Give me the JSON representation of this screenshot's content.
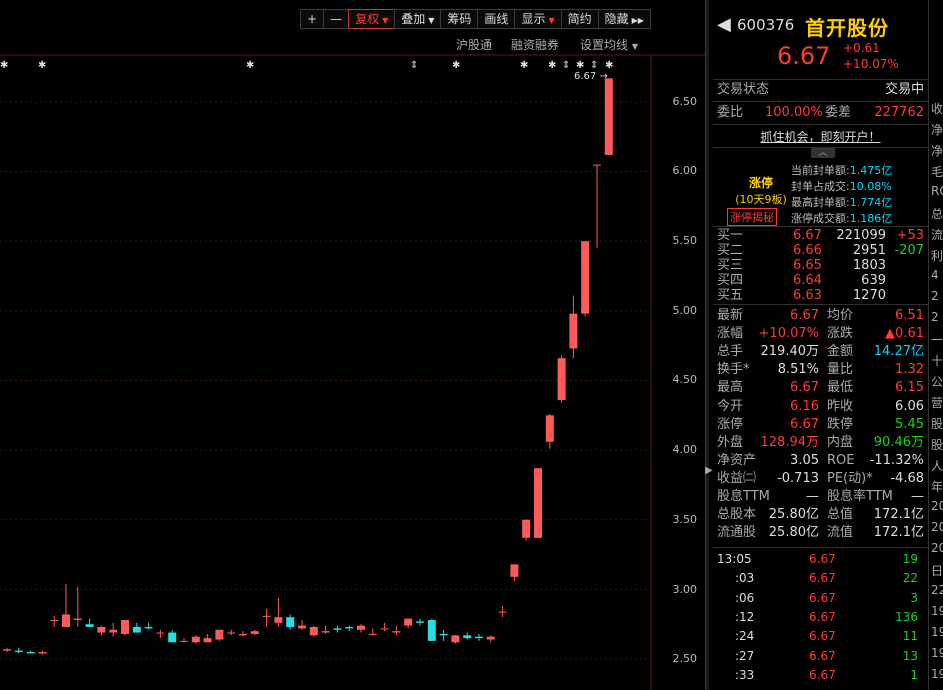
{
  "toolbar": {
    "plus": "+",
    "minus": "—",
    "items": [
      {
        "label": "复权",
        "caret": "▼"
      },
      {
        "label": "叠加",
        "caret": "▼"
      },
      {
        "label": "筹码"
      },
      {
        "label": "画线"
      },
      {
        "label": "显示",
        "caret": "▼"
      },
      {
        "label": "简约"
      },
      {
        "label": "隐藏",
        "caret": "▶▶"
      }
    ]
  },
  "subnav": [
    "沪股通",
    "融资融券",
    "设置均线"
  ],
  "subnav_caret": "▼",
  "price_marker": "6.67",
  "y_ticks": [
    "6.50",
    "6.00",
    "5.50",
    "5.00",
    "4.50",
    "4.00",
    "3.50",
    "3.00",
    "2.50"
  ],
  "colors": {
    "up": "#ff5a5a",
    "down": "#22e1e6",
    "bg": "#000000",
    "grid": "#3a1010",
    "accent": "#ffcc00"
  },
  "chart_data": {
    "type": "candlestick",
    "ylim": [
      2.3,
      6.9
    ],
    "ohlc": [
      [
        2.56,
        2.58,
        2.55,
        2.57
      ],
      [
        2.56,
        2.58,
        2.54,
        2.55
      ],
      [
        2.55,
        2.56,
        2.54,
        2.54
      ],
      [
        2.54,
        2.56,
        2.53,
        2.55
      ],
      [
        2.78,
        2.81,
        2.73,
        2.78
      ],
      [
        2.73,
        3.04,
        2.73,
        2.82
      ],
      [
        2.78,
        3.02,
        2.73,
        2.79
      ],
      [
        2.75,
        2.79,
        2.73,
        2.73
      ],
      [
        2.69,
        2.74,
        2.67,
        2.73
      ],
      [
        2.69,
        2.76,
        2.66,
        2.71
      ],
      [
        2.68,
        2.78,
        2.67,
        2.78
      ],
      [
        2.73,
        2.76,
        2.69,
        2.69
      ],
      [
        2.73,
        2.76,
        2.71,
        2.72
      ],
      [
        2.69,
        2.71,
        2.65,
        2.69
      ],
      [
        2.69,
        2.71,
        2.62,
        2.62
      ],
      [
        2.63,
        2.65,
        2.62,
        2.63
      ],
      [
        2.62,
        2.67,
        2.61,
        2.66
      ],
      [
        2.62,
        2.68,
        2.62,
        2.65
      ],
      [
        2.64,
        2.7,
        2.63,
        2.71
      ],
      [
        2.69,
        2.71,
        2.67,
        2.69
      ],
      [
        2.67,
        2.7,
        2.66,
        2.68
      ],
      [
        2.68,
        2.71,
        2.67,
        2.7
      ],
      [
        2.81,
        2.86,
        2.73,
        2.81
      ],
      [
        2.76,
        2.94,
        2.73,
        2.8
      ],
      [
        2.8,
        2.82,
        2.71,
        2.73
      ],
      [
        2.72,
        2.78,
        2.71,
        2.74
      ],
      [
        2.67,
        2.74,
        2.66,
        2.73
      ],
      [
        2.69,
        2.74,
        2.68,
        2.7
      ],
      [
        2.72,
        2.74,
        2.69,
        2.71
      ],
      [
        2.73,
        2.74,
        2.7,
        2.72
      ],
      [
        2.71,
        2.75,
        2.69,
        2.74
      ],
      [
        2.68,
        2.72,
        2.67,
        2.68
      ],
      [
        2.72,
        2.76,
        2.7,
        2.72
      ],
      [
        2.69,
        2.74,
        2.67,
        2.7
      ],
      [
        2.74,
        2.78,
        2.72,
        2.79
      ],
      [
        2.77,
        2.79,
        2.74,
        2.76
      ],
      [
        2.78,
        2.79,
        2.63,
        2.63
      ],
      [
        2.68,
        2.71,
        2.63,
        2.67
      ],
      [
        2.62,
        2.67,
        2.61,
        2.67
      ],
      [
        2.67,
        2.69,
        2.64,
        2.65
      ],
      [
        2.66,
        2.68,
        2.63,
        2.65
      ],
      [
        2.64,
        2.67,
        2.62,
        2.66
      ],
      [
        2.84,
        2.88,
        2.8,
        2.84
      ],
      [
        3.09,
        3.18,
        3.06,
        3.18
      ],
      [
        3.37,
        3.5,
        3.35,
        3.5
      ],
      [
        3.37,
        3.87,
        3.37,
        3.87
      ],
      [
        4.06,
        4.26,
        4.01,
        4.25
      ],
      [
        4.36,
        4.68,
        4.34,
        4.66
      ],
      [
        4.73,
        5.11,
        4.66,
        4.98
      ],
      [
        4.98,
        5.5,
        4.96,
        5.5
      ],
      [
        6.05,
        6.05,
        5.45,
        6.05
      ],
      [
        6.12,
        6.67,
        6.12,
        6.67
      ]
    ]
  },
  "stock": {
    "code": "600376",
    "name": "首开股份",
    "price": "6.67",
    "change": "+0.61",
    "pct": "+10.07%",
    "status_label": "交易状态",
    "status_value": "交易中",
    "wb_label": "委比",
    "wb_value": "100.00%",
    "wc_label": "委差",
    "wc_value": "227762",
    "promo": "抓住机会，即刻开户！",
    "limit_label": "涨停",
    "limit_sub": "(10天9板)",
    "limit_btn": "涨停揭秘",
    "limit_info": [
      {
        "k": "当前封单额:",
        "v": "1.475亿"
      },
      {
        "k": "封单占成交:",
        "v": "10.08%"
      },
      {
        "k": "最高封单额:",
        "v": "1.774亿"
      },
      {
        "k": "涨停成交额:",
        "v": "1.186亿"
      }
    ],
    "book": [
      {
        "label": "买一",
        "price": "6.67",
        "vol": "221099",
        "chg": "+53",
        "chg_color": "red"
      },
      {
        "label": "买二",
        "price": "6.66",
        "vol": "2951",
        "chg": "-207",
        "chg_color": "grn"
      },
      {
        "label": "买三",
        "price": "6.65",
        "vol": "1803",
        "chg": ""
      },
      {
        "label": "买四",
        "price": "6.64",
        "vol": "639",
        "chg": ""
      },
      {
        "label": "买五",
        "price": "6.63",
        "vol": "1270",
        "chg": ""
      }
    ],
    "stats": [
      {
        "l1": "最新",
        "v1": "6.67",
        "c1": "red",
        "l2": "均价",
        "v2": "6.51",
        "c2": "red"
      },
      {
        "l1": "涨幅",
        "v1": "+10.07%",
        "c1": "red",
        "l2": "涨跌",
        "v2": "▲0.61",
        "c2": "red"
      },
      {
        "l1": "总手",
        "v1": "219.40万",
        "c1": "wht",
        "l2": "金额",
        "v2": "14.27亿",
        "c2": "cyan"
      },
      {
        "l1": "换手*",
        "v1": "8.51%",
        "c1": "wht",
        "l2": "量比",
        "v2": "1.32",
        "c2": "red"
      },
      {
        "l1": "最高",
        "v1": "6.67",
        "c1": "red",
        "l2": "最低",
        "v2": "6.15",
        "c2": "red"
      },
      {
        "l1": "今开",
        "v1": "6.16",
        "c1": "red",
        "l2": "昨收",
        "v2": "6.06",
        "c2": "wht"
      },
      {
        "l1": "涨停",
        "v1": "6.67",
        "c1": "red",
        "l2": "跌停",
        "v2": "5.45",
        "c2": "grn"
      },
      {
        "l1": "外盘",
        "v1": "128.94万",
        "c1": "red",
        "l2": "内盘",
        "v2": "90.46万",
        "c2": "grn"
      },
      {
        "l1": "净资产",
        "v1": "3.05",
        "c1": "wht",
        "l2": "ROE",
        "v2": "-11.32%",
        "c2": "wht"
      },
      {
        "l1": "收益㈡",
        "v1": "-0.713",
        "c1": "wht",
        "l2": "PE(动)*",
        "v2": "-4.68",
        "c2": "wht"
      },
      {
        "l1": "股息TTM",
        "v1": "—",
        "c1": "wht",
        "l2": "股息率TTM",
        "v2": "—",
        "c2": "wht"
      },
      {
        "l1": "总股本",
        "v1": "25.80亿",
        "c1": "wht",
        "l2": "总值",
        "v2": "172.1亿",
        "c2": "wht"
      },
      {
        "l1": "流通股",
        "v1": "25.80亿",
        "c1": "wht",
        "l2": "流值",
        "v2": "172.1亿",
        "c2": "wht"
      }
    ],
    "ticks": [
      {
        "t": "13:05",
        "p": "6.67",
        "v": "19"
      },
      {
        "t": ":03",
        "p": "6.67",
        "v": "22"
      },
      {
        "t": ":06",
        "p": "6.67",
        "v": "3"
      },
      {
        "t": ":12",
        "p": "6.67",
        "v": "136"
      },
      {
        "t": ":24",
        "p": "6.67",
        "v": "11"
      },
      {
        "t": ":27",
        "p": "6.67",
        "v": "13"
      },
      {
        "t": ":33",
        "p": "6.67",
        "v": "1"
      }
    ]
  },
  "edge_labels": [
    "收",
    "净",
    "净",
    "毛",
    "RO",
    "总",
    "流",
    "利",
    "4",
    "2",
    "2",
    "一",
    "十",
    "公",
    "营",
    "股",
    "股",
    "人",
    "年",
    "20",
    "20",
    "20",
    "日",
    "22",
    "19",
    "19",
    "19",
    "19"
  ]
}
